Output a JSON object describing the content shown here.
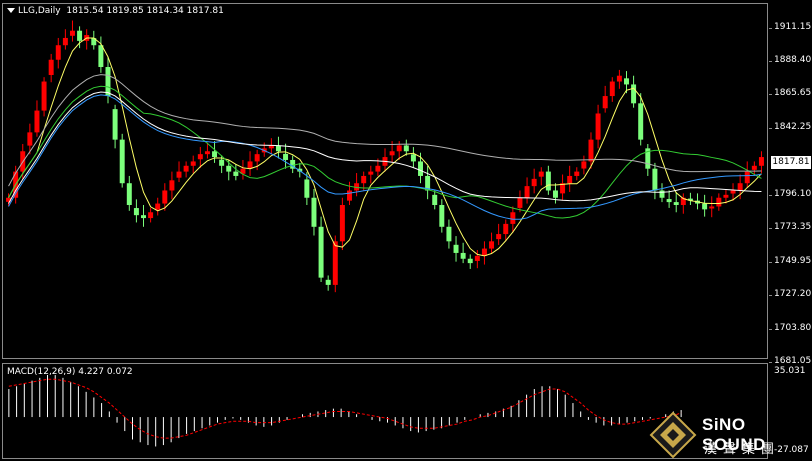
{
  "header": {
    "symbol": "LLG,Daily",
    "open": "1815.54",
    "high": "1819.85",
    "low": "1814.34",
    "close": "1817.81"
  },
  "macd": {
    "label": "MACD(12,26,9)",
    "value1": "4.227",
    "value2": "0.072",
    "axis_top": "35.031",
    "axis_bottom": "-27.087"
  },
  "current_price": "1817.81",
  "logo": {
    "line1": "SiNO SOUND",
    "line2": "漢聲集團"
  },
  "colors": {
    "up": "#ff0000",
    "down": "#7cff7c",
    "ma_yellow": "#ffff66",
    "ma_white": "#ffffff",
    "ma_green": "#33cc33",
    "ma_blue": "#3399ff",
    "ma_gray": "#b0b0b0",
    "signal": "#ff0000",
    "hist": "#ffffff"
  },
  "chart_data": {
    "type": "candlestick",
    "y_ticks": [
      "1911.15",
      "1888.40",
      "1865.65",
      "1842.25",
      "1817.81",
      "1796.10",
      "1773.35",
      "1749.95",
      "1727.20",
      "1703.80",
      "1681.05"
    ],
    "ylim": [
      1681.05,
      1922.0
    ],
    "close_series": [
      1790,
      1808,
      1822,
      1835,
      1850,
      1870,
      1885,
      1895,
      1900,
      1905,
      1898,
      1902,
      1895,
      1880,
      1860,
      1830,
      1800,
      1785,
      1778,
      1776,
      1780,
      1786,
      1795,
      1802,
      1808,
      1812,
      1815,
      1820,
      1822,
      1818,
      1812,
      1808,
      1805,
      1810,
      1815,
      1820,
      1824,
      1826,
      1822,
      1816,
      1810,
      1808,
      1790,
      1770,
      1735,
      1730,
      1760,
      1785,
      1795,
      1800,
      1805,
      1808,
      1812,
      1818,
      1822,
      1826,
      1822,
      1815,
      1805,
      1795,
      1785,
      1770,
      1760,
      1752,
      1748,
      1745,
      1750,
      1755,
      1760,
      1765,
      1772,
      1780,
      1790,
      1798,
      1803,
      1808,
      1795,
      1790,
      1800,
      1805,
      1808,
      1815,
      1830,
      1848,
      1860,
      1870,
      1874,
      1868,
      1855,
      1830,
      1810,
      1795,
      1790,
      1787,
      1785,
      1790,
      1788,
      1786,
      1782,
      1784,
      1790,
      1792,
      1795,
      1800,
      1808,
      1812,
      1818
    ],
    "macd_hist": [
      20,
      22,
      24,
      26,
      28,
      30,
      30,
      28,
      25,
      22,
      18,
      14,
      10,
      4,
      -4,
      -10,
      -16,
      -18,
      -20,
      -21,
      -20,
      -18,
      -15,
      -12,
      -10,
      -8,
      -6,
      -4,
      -2,
      -1,
      -2,
      -4,
      -6,
      -7,
      -6,
      -4,
      -2,
      0,
      2,
      3,
      4,
      5,
      6,
      6,
      4,
      2,
      0,
      -2,
      -3,
      -4,
      -6,
      -8,
      -10,
      -11,
      -10,
      -9,
      -8,
      -6,
      -4,
      -2,
      0,
      2,
      3,
      4,
      6,
      8,
      12,
      16,
      20,
      22,
      22,
      20,
      16,
      10,
      4,
      -2,
      -4,
      -6,
      -6,
      -5,
      -4,
      -3,
      -2,
      -1,
      0,
      2,
      4,
      5
    ],
    "macd_signal": [
      22,
      23,
      24,
      25,
      26,
      27,
      27,
      26,
      25,
      23,
      21,
      18,
      14,
      10,
      5,
      0,
      -5,
      -9,
      -12,
      -14,
      -15,
      -15,
      -14,
      -13,
      -11,
      -9,
      -7,
      -5,
      -4,
      -3,
      -3,
      -3,
      -4,
      -4,
      -4,
      -3,
      -2,
      -1,
      0,
      1,
      2,
      3,
      4,
      4,
      4,
      3,
      2,
      1,
      0,
      -1,
      -3,
      -5,
      -7,
      -8,
      -8,
      -8,
      -7,
      -6,
      -5,
      -3,
      -2,
      0,
      1,
      3,
      5,
      7,
      10,
      13,
      16,
      18,
      20,
      20,
      18,
      14,
      10,
      5,
      1,
      -2,
      -4,
      -5,
      -5,
      -4,
      -3,
      -2,
      -1,
      0,
      1,
      3
    ]
  }
}
